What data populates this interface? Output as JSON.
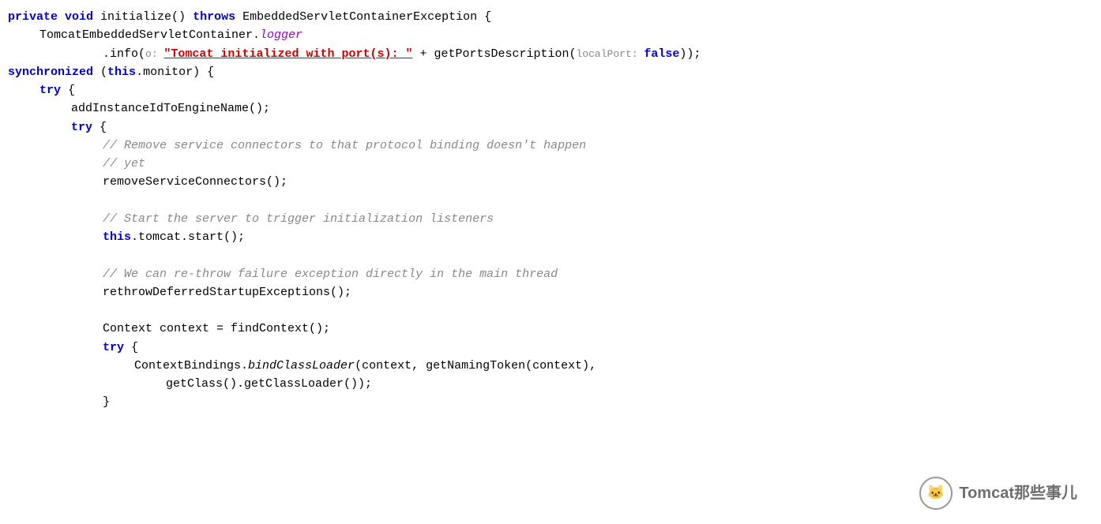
{
  "code": {
    "lines": [
      {
        "id": "line1",
        "parts": [
          {
            "text": "private ",
            "class": "kw"
          },
          {
            "text": "void ",
            "class": "kw"
          },
          {
            "text": "initialize() ",
            "class": "method"
          },
          {
            "text": "throws ",
            "class": "kw"
          },
          {
            "text": "EmbeddedServletContainerException {",
            "class": "plain"
          }
        ]
      },
      {
        "id": "line2",
        "indent": 1,
        "parts": [
          {
            "text": "TomcatEmbeddedServletContainer.",
            "class": "plain"
          },
          {
            "text": "logger",
            "class": "purple"
          }
        ]
      },
      {
        "id": "line3",
        "indent": 3,
        "parts": [
          {
            "text": ".info(",
            "class": "plain"
          },
          {
            "text": "o: ",
            "class": "param-hint"
          },
          {
            "text": "\"Tomcat initialized with port(s): \"",
            "class": "string-red"
          },
          {
            "text": " + getPortsDescription(",
            "class": "plain"
          },
          {
            "text": "localPort: ",
            "class": "param-hint"
          },
          {
            "text": "false",
            "class": "false-kw"
          },
          {
            "text": "));",
            "class": "plain"
          }
        ]
      },
      {
        "id": "line4",
        "parts": [
          {
            "text": "synchronized ",
            "class": "kw"
          },
          {
            "text": "(",
            "class": "plain"
          },
          {
            "text": "this",
            "class": "kw"
          },
          {
            "text": ".monitor) {",
            "class": "plain"
          }
        ]
      },
      {
        "id": "line5",
        "indent": 1,
        "parts": [
          {
            "text": "try {",
            "class": "plain"
          }
        ]
      },
      {
        "id": "line6",
        "indent": 2,
        "parts": [
          {
            "text": "addInstanceIdToEngineName();",
            "class": "plain"
          }
        ]
      },
      {
        "id": "line7",
        "indent": 2,
        "parts": [
          {
            "text": "try {",
            "class": "plain"
          }
        ]
      },
      {
        "id": "line8",
        "indent": 3,
        "parts": [
          {
            "text": "// Remove service connectors to that protocol binding doesn't happen",
            "class": "comment"
          }
        ]
      },
      {
        "id": "line9",
        "indent": 3,
        "parts": [
          {
            "text": "// yet",
            "class": "comment"
          }
        ]
      },
      {
        "id": "line10",
        "indent": 3,
        "parts": [
          {
            "text": "removeServiceConnectors();",
            "class": "plain"
          }
        ]
      },
      {
        "id": "line11",
        "indent": 3,
        "parts": [
          {
            "text": "",
            "class": "plain"
          }
        ]
      },
      {
        "id": "line12",
        "indent": 3,
        "parts": [
          {
            "text": "// Start the server to trigger initialization listeners",
            "class": "comment"
          }
        ]
      },
      {
        "id": "line13",
        "indent": 3,
        "parts": [
          {
            "text": "this",
            "class": "kw"
          },
          {
            "text": ".tomcat.start();",
            "class": "plain"
          }
        ]
      },
      {
        "id": "line14",
        "indent": 3,
        "parts": [
          {
            "text": "",
            "class": "plain"
          }
        ]
      },
      {
        "id": "line15",
        "indent": 3,
        "parts": [
          {
            "text": "// We can re-throw failure exception directly in the main thread",
            "class": "comment"
          }
        ]
      },
      {
        "id": "line16",
        "indent": 3,
        "parts": [
          {
            "text": "rethrowDeferredStartupExceptions();",
            "class": "plain"
          }
        ]
      },
      {
        "id": "line17",
        "indent": 3,
        "parts": [
          {
            "text": "",
            "class": "plain"
          }
        ]
      },
      {
        "id": "line18",
        "indent": 3,
        "parts": [
          {
            "text": "Context context = findContext();",
            "class": "plain"
          }
        ]
      },
      {
        "id": "line19",
        "indent": 3,
        "parts": [
          {
            "text": "try {",
            "class": "plain"
          }
        ]
      },
      {
        "id": "line20",
        "indent": 4,
        "parts": [
          {
            "text": "ContextBindings.",
            "class": "plain"
          },
          {
            "text": "bindClassLoader",
            "class": "italic-method"
          },
          {
            "text": "(context, getNamingTok",
            "class": "plain"
          },
          {
            "text": "en(context),",
            "class": "plain"
          }
        ]
      },
      {
        "id": "line21",
        "indent": 5,
        "parts": [
          {
            "text": "getClass().getClassLoader());",
            "class": "plain"
          }
        ]
      },
      {
        "id": "line22",
        "indent": 3,
        "parts": [
          {
            "text": "}",
            "class": "plain"
          }
        ]
      }
    ],
    "watermark": {
      "text": "Tomcat那些事儿"
    }
  }
}
